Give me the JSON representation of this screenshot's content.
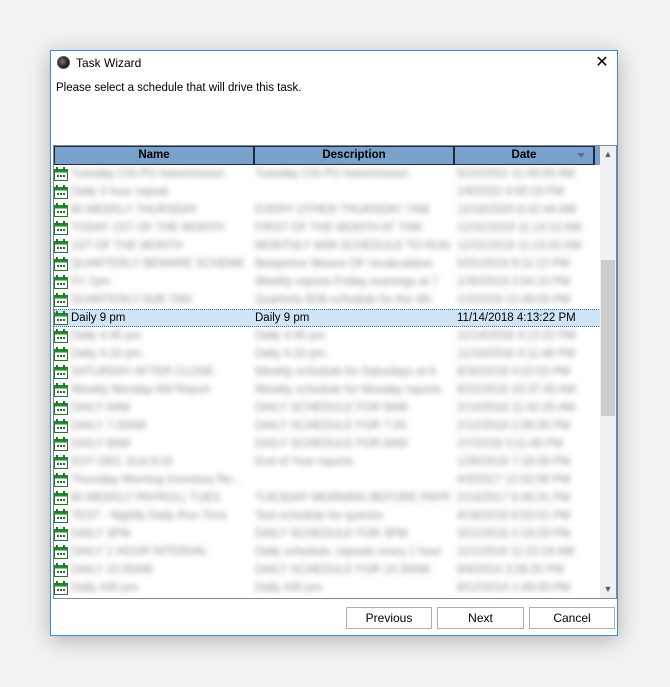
{
  "dialog": {
    "title": "Task Wizard",
    "instruction": "Please select a schedule that will drive this task."
  },
  "table": {
    "columns": [
      "Name",
      "Description",
      "Date"
    ],
    "rows": [
      {
        "name": "Tuesday CSI PO transmission",
        "description": "Tuesday CSI PO transmission",
        "date": "5/10/2022 11:45:55 AM",
        "blurred": true
      },
      {
        "name": "Daily 3 hour repeat",
        "description": "",
        "date": "1/6/2022 4:00:19 PM",
        "blurred": true
      },
      {
        "name": "BI-WEEKLY THURSDAY",
        "description": "EVERY OTHER THURSDAY 7AM",
        "date": "12/16/2020 8:42:44 AM",
        "blurred": true
      },
      {
        "name": "TODAY 1ST OF THE MONTH",
        "description": "FIRST OF THE MONTH AT 7AM",
        "date": "12/31/2019 11:14:12 AM",
        "blurred": true
      },
      {
        "name": "1ST OF THE MONTH",
        "description": "MONTHLY 4AM SCHEDULE TO RUN",
        "date": "12/31/2019 11:13:42 AM",
        "blurred": true
      },
      {
        "name": "QUARTERLY BEWARE SCHEME",
        "description": "Beeperine Weave OF recalculation",
        "date": "5/31/2019 9:11:12 PM",
        "blurred": true
      },
      {
        "name": "Fri 7pm",
        "description": "Weekly reports Friday evenings at 7",
        "date": "1/30/2019 3:54:10 PM",
        "blurred": true
      },
      {
        "name": "QUARTERLY B2B TAM",
        "description": "Quarterly B2B schedule for the 4th",
        "date": "1/2/2019 12:48:55 PM",
        "blurred": true
      },
      {
        "name": "Daily 9 pm",
        "description": "Daily 9 pm",
        "date": "11/14/2018 4:13:22 PM",
        "blurred": false,
        "selected": true
      },
      {
        "name": "Daily 4:45 pm",
        "description": "Daily 4:45 pm",
        "date": "11/14/2018 4:12:22 PM",
        "blurred": true
      },
      {
        "name": "Daily 4:15 pm",
        "description": "Daily 4:15 pm",
        "date": "11/14/2018 4:11:48 PM",
        "blurred": true
      },
      {
        "name": "SATURDAY AFTER CLOSE",
        "description": "Weekly schedule for Saturdays at 6",
        "date": "8/30/2018 4:22:02 PM",
        "blurred": true
      },
      {
        "name": "Weekly Monday AM Report",
        "description": "Weekly schedule for Monday reports",
        "date": "8/22/2018 10:37:40 AM",
        "blurred": true
      },
      {
        "name": "DAILY 6AM",
        "description": "DAILY SCHEDULE FOR 6AM",
        "date": "2/14/2018 11:42:25 AM",
        "blurred": true
      },
      {
        "name": "DAILY 7:20AM",
        "description": "DAILY SCHEDULE FOR 7:20",
        "date": "2/12/2018 2:08:35 PM",
        "blurred": true
      },
      {
        "name": "DAILY 8AM",
        "description": "DAILY SCHEDULE FOR 8AM",
        "date": "2/7/2018 3:11:48 PM",
        "blurred": true
      },
      {
        "name": "EOY DEC 31st 8:15",
        "description": "End of Year reports",
        "date": "1/30/2018 7:18:08 PM",
        "blurred": true
      },
      {
        "name": "Thursday Morning Inventory Re...",
        "description": "",
        "date": "4/3/2017 12:02:06 PM",
        "blurred": true
      },
      {
        "name": "BI-WEEKLY PAYROLL TUES",
        "description": "TUESDAY MORNING BEFORE PAYR...",
        "date": "2/14/2017 6:45:31 PM",
        "blurred": true
      },
      {
        "name": "TEST - Nightly Daily Run Time",
        "description": "Test schedule for queries",
        "date": "4/18/2016 8:53:01 PM",
        "blurred": true
      },
      {
        "name": "DAILY 3PM",
        "description": "DAILY SCHEDULE FOR 3PM",
        "date": "3/21/2016 2:19:29 PM",
        "blurred": true
      },
      {
        "name": "DAILY 1 HOUR INTERVAL",
        "description": "Daily schedule, repeats every 1 hour",
        "date": "11/1/2016 11:22:24 AM",
        "blurred": true
      },
      {
        "name": "DAILY 10:30AM",
        "description": "DAILY SCHEDULE FOR 10:30AM",
        "date": "8/4/2014 3:28:25 PM",
        "blurred": true
      },
      {
        "name": "Daily 430 pm",
        "description": "Daily 430 pm",
        "date": "8/12/2014 1:48:00 PM",
        "blurred": true
      }
    ]
  },
  "buttons": {
    "previous": "Previous",
    "next": "Next",
    "cancel": "Cancel"
  },
  "icons": {
    "app": "app-icon",
    "close": "close-icon",
    "row": "calendar-icon"
  },
  "colors": {
    "accent_border": "#3c8ed8",
    "header_bg": "#7aa0cc",
    "selected_bg": "#cfe4f5",
    "calendar_green": "#1f8f2a"
  }
}
